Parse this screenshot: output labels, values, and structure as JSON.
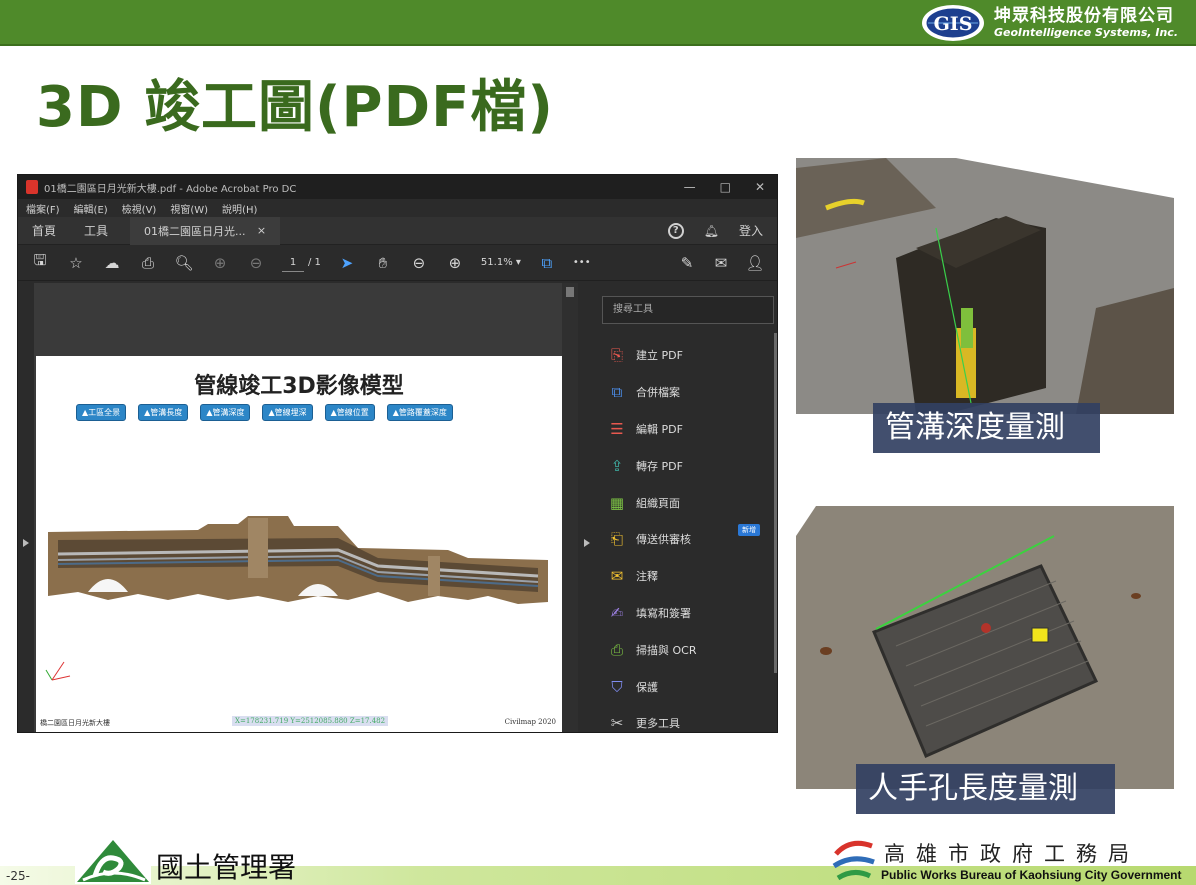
{
  "header": {
    "company_zh": "坤眾科技股份有限公司",
    "company_en": "GeoIntelligence Systems, Inc.",
    "logo_text": "GIS"
  },
  "slide": {
    "title": "3D 竣工圖(PDF檔)",
    "page_number": "-25-"
  },
  "acrobat": {
    "window_title": "01橋二園區日月光新大樓.pdf - Adobe Acrobat Pro DC",
    "window_controls": [
      "—",
      "□",
      "✕"
    ],
    "menu": [
      "檔案(F)",
      "編輯(E)",
      "檢視(V)",
      "視窗(W)",
      "說明(H)"
    ],
    "tabs": {
      "home": "首頁",
      "tools": "工具",
      "document": "01橋二園區日月光...",
      "close": "×",
      "sign_in": "登入"
    },
    "toolbar": {
      "page_current": "1",
      "page_total": "/ 1",
      "zoom": "51.1%",
      "more": "•••"
    },
    "pdf": {
      "heading": "管線竣工3D影像模型",
      "buttons": [
        "▲工區全景",
        "▲管溝長度",
        "▲管溝深度",
        "▲管線埋深",
        "▲管線位置",
        "▲管路覆蓋深度"
      ],
      "footer_left": "橋二園區日月光新大樓",
      "footer_coord": "X=178231.719  Y=2512085.880  Z=17.482",
      "footer_right": "Civilmap 2020"
    },
    "tools_panel": {
      "search_placeholder": "搜尋工具",
      "items": [
        {
          "label": "建立 PDF",
          "icon": "create-pdf-icon",
          "color": "#e8584f"
        },
        {
          "label": "合併檔案",
          "icon": "combine-files-icon",
          "color": "#4b8ce8"
        },
        {
          "label": "編輯 PDF",
          "icon": "edit-pdf-icon",
          "color": "#e8584f"
        },
        {
          "label": "轉存 PDF",
          "icon": "export-pdf-icon",
          "color": "#3fb6a8"
        },
        {
          "label": "組織頁面",
          "icon": "organize-pages-icon",
          "color": "#7bc043"
        },
        {
          "label": "傳送供審核",
          "icon": "send-review-icon",
          "color": "#f2c230",
          "badge": "新增"
        },
        {
          "label": "注釋",
          "icon": "comment-icon",
          "color": "#f2c230"
        },
        {
          "label": "填寫和簽署",
          "icon": "fill-sign-icon",
          "color": "#9b7fe0"
        },
        {
          "label": "掃描與 OCR",
          "icon": "scan-ocr-icon",
          "color": "#7bc043"
        },
        {
          "label": "保護",
          "icon": "protect-icon",
          "color": "#7f8cf0"
        },
        {
          "label": "更多工具",
          "icon": "more-tools-icon",
          "color": "#cccccc"
        }
      ]
    }
  },
  "photos": {
    "trench_caption": "管溝深度量測",
    "manhole_caption": "人手孔長度量測"
  },
  "footer": {
    "agency_left": "國土管理署",
    "agency_right_zh": "高雄市政府工務局",
    "agency_right_en": "Public Works Bureau of Kaohsiung City Government"
  },
  "colors": {
    "brand_green": "#4f8a2a",
    "title_green": "#3a6a1e",
    "caption_bg": "#324062",
    "pdf_button": "#2c86c7"
  }
}
